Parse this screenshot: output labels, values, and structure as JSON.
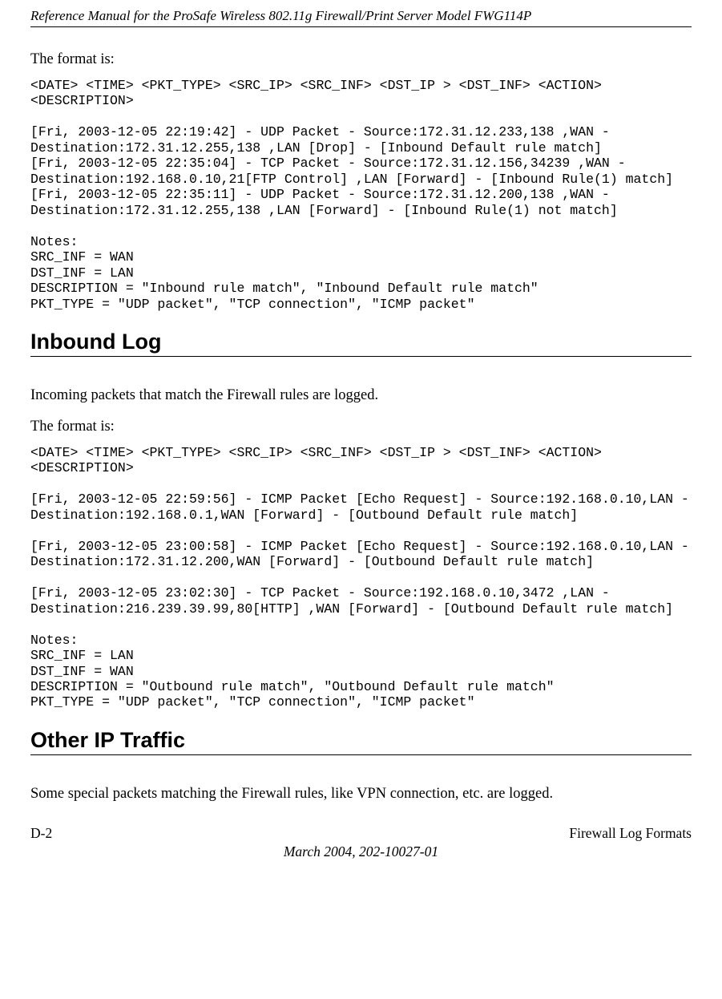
{
  "header": {
    "title": "Reference Manual for the ProSafe Wireless 802.11g  Firewall/Print Server Model FWG114P"
  },
  "intro": {
    "format_label": "The format is:"
  },
  "block1": {
    "text": "<DATE> <TIME> <PKT_TYPE> <SRC_IP> <SRC_INF> <DST_IP > <DST_INF> <ACTION><DESCRIPTION>\n\n[Fri, 2003-12-05 22:19:42] - UDP Packet - Source:172.31.12.233,138 ,WAN - Destination:172.31.12.255,138 ,LAN [Drop] - [Inbound Default rule match]\n[Fri, 2003-12-05 22:35:04] - TCP Packet - Source:172.31.12.156,34239 ,WAN - Destination:192.168.0.10,21[FTP Control] ,LAN [Forward] - [Inbound Rule(1) match]\n[Fri, 2003-12-05 22:35:11] - UDP Packet - Source:172.31.12.200,138 ,WAN - Destination:172.31.12.255,138 ,LAN [Forward] - [Inbound Rule(1) not match]\n\nNotes:\nSRC_INF = WAN\nDST_INF = LAN\nDESCRIPTION = \"Inbound rule match\", \"Inbound Default rule match\"\nPKT_TYPE = \"UDP packet\", \"TCP connection\", \"ICMP packet\""
  },
  "section_inbound": {
    "heading": "Inbound Log",
    "intro": "Incoming packets that match the Firewall rules are logged.",
    "format_label": "The format is:"
  },
  "block2": {
    "text": "<DATE> <TIME> <PKT_TYPE> <SRC_IP> <SRC_INF> <DST_IP > <DST_INF> <ACTION><DESCRIPTION>\n\n[Fri, 2003-12-05 22:59:56] - ICMP Packet [Echo Request] - Source:192.168.0.10,LAN - Destination:192.168.0.1,WAN [Forward] - [Outbound Default rule match]\n\n[Fri, 2003-12-05 23:00:58] - ICMP Packet [Echo Request] - Source:192.168.0.10,LAN - Destination:172.31.12.200,WAN [Forward] - [Outbound Default rule match]\n\n[Fri, 2003-12-05 23:02:30] - TCP Packet - Source:192.168.0.10,3472 ,LAN - Destination:216.239.39.99,80[HTTP] ,WAN [Forward] - [Outbound Default rule match]\n\nNotes:\nSRC_INF = LAN\nDST_INF = WAN\nDESCRIPTION = \"Outbound rule match\", \"Outbound Default rule match\"\nPKT_TYPE = \"UDP packet\", \"TCP connection\", \"ICMP packet\""
  },
  "section_other": {
    "heading": "Other IP Traffic",
    "intro": "Some special packets matching the Firewall rules, like VPN connection, etc. are logged."
  },
  "footer": {
    "page_num": "D-2",
    "right": "Firewall Log Formats",
    "center": "March 2004, 202-10027-01"
  }
}
